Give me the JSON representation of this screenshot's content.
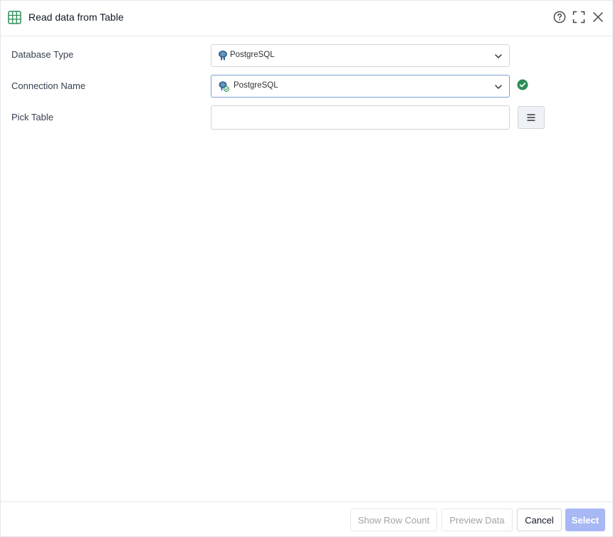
{
  "dialog": {
    "title": "Read data from Table",
    "icons": {
      "header": "table-icon",
      "help": "help-circle-icon",
      "maximize": "maximize-icon",
      "close": "close-icon"
    }
  },
  "form": {
    "database_type": {
      "label": "Database Type",
      "value": "PostgreSQL",
      "icon": "postgresql-icon"
    },
    "connection_name": {
      "label": "Connection Name",
      "value": "PostgreSQL",
      "icon": "postgresql-connection-icon",
      "status_icon": "check-circle-icon",
      "status_color": "#2e8b57"
    },
    "pick_table": {
      "label": "Pick Table",
      "value": "",
      "placeholder": "",
      "browse_icon": "list-icon"
    }
  },
  "footer": {
    "show_row_count": "Show Row Count",
    "preview_data": "Preview Data",
    "cancel": "Cancel",
    "select": "Select"
  },
  "colors": {
    "accent": "#a7b8f5",
    "icon_green": "#2e8b57",
    "focus_border": "#7a9fd6"
  }
}
